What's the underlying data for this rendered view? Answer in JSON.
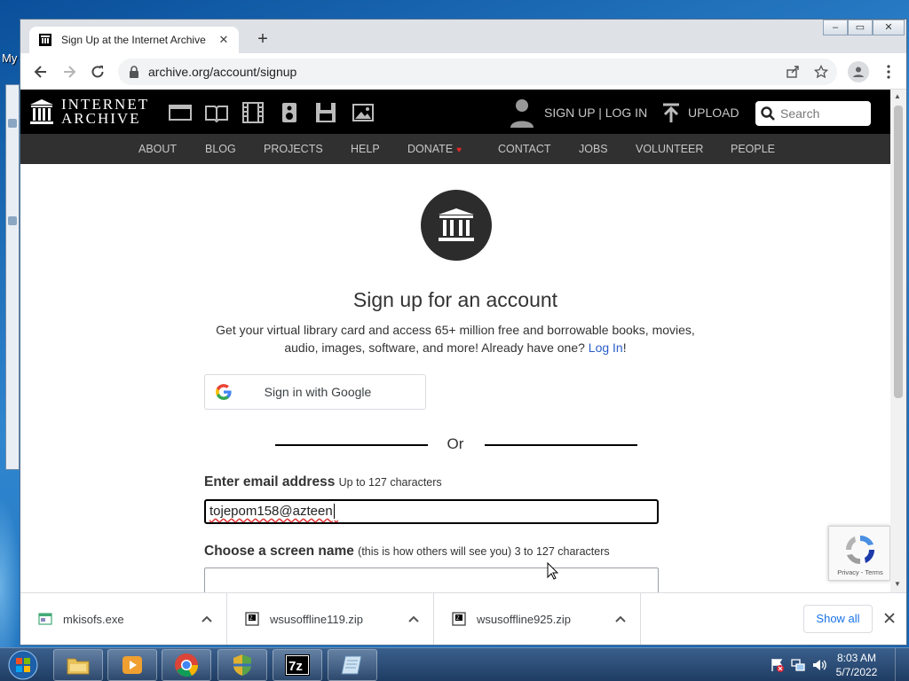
{
  "desktop": {
    "label": "My"
  },
  "browser": {
    "tab_title": "Sign Up at the Internet Archive",
    "url": "archive.org/account/signup"
  },
  "ia_header": {
    "logo_line1": "INTERNET",
    "logo_line2": "ARCHIVE",
    "signup_login": "SIGN UP | LOG IN",
    "upload": "UPLOAD",
    "search_placeholder": "Search",
    "media_icons": [
      "web-icon",
      "texts-icon",
      "video-icon",
      "audio-icon",
      "software-icon",
      "images-icon"
    ],
    "nav": [
      "ABOUT",
      "BLOG",
      "PROJECTS",
      "HELP",
      "DONATE",
      "CONTACT",
      "JOBS",
      "VOLUNTEER",
      "PEOPLE"
    ]
  },
  "signup": {
    "title": "Sign up for an account",
    "intro": "Get your virtual library card and access 65+ million free and borrowable books, movies, audio, images, software, and more! Already have one? ",
    "login_link": "Log In",
    "intro_end": "!",
    "google_button": "Sign in with Google",
    "or": "Or",
    "email_label": "Enter email address",
    "email_hint": "Up to 127 characters",
    "email_value": "tojepom158@azteen",
    "screen_label": "Choose a screen name",
    "screen_hint": "(this is how others will see you) 3 to 127 characters"
  },
  "recaptcha": {
    "text": "Privacy - Terms"
  },
  "downloads": [
    {
      "name": "mkisofs.exe",
      "icon": "exe-file-icon"
    },
    {
      "name": "wsusoffline119.zip",
      "icon": "7z-archive-icon"
    },
    {
      "name": "wsusoffline925.zip",
      "icon": "7z-archive-icon"
    }
  ],
  "download_bar": {
    "show_all": "Show all"
  },
  "taskbar": {
    "items": [
      "explorer-icon",
      "media-player-icon",
      "chrome-icon",
      "security-shield-icon",
      "7zip-icon",
      "notepad-icon"
    ],
    "time": "8:03 AM",
    "date": "5/7/2022"
  },
  "colors": {
    "ia_black": "#000000",
    "ia_nav": "#303030",
    "link": "#2b5ec9",
    "donate_heart": "#e02a2a"
  }
}
